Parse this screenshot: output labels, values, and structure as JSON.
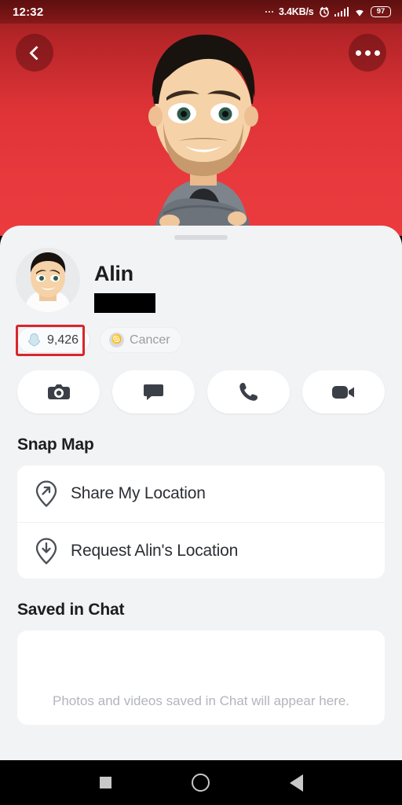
{
  "statusbar": {
    "time": "12:32",
    "network_speed": "3.4KB/s",
    "battery_level": "97",
    "icons": [
      "alarm-icon",
      "signal-icon",
      "wifi-icon",
      "battery-icon"
    ]
  },
  "hero": {
    "back_icon": "chevron-left-icon",
    "more_icon": "more-options-icon",
    "avatar_alt": "bitmoji-avatar",
    "background_color": "#e8393d"
  },
  "profile": {
    "display_name": "Alin",
    "username_redacted": "",
    "snapscore": "9,426",
    "snapscore_icon": "snapchat-ghost-icon",
    "zodiac": "Cancer",
    "zodiac_icon": "cancer-zodiac-icon",
    "highlight_color": "#d8262c"
  },
  "actions": [
    {
      "name": "camera",
      "icon": "camera-icon"
    },
    {
      "name": "chat",
      "icon": "chat-bubble-icon"
    },
    {
      "name": "call",
      "icon": "phone-icon"
    },
    {
      "name": "video",
      "icon": "video-camera-icon"
    }
  ],
  "snap_map": {
    "title": "Snap Map",
    "rows": [
      {
        "label": "Share My Location",
        "icon": "location-pin-share-icon"
      },
      {
        "label": "Request Alin's Location",
        "icon": "location-pin-request-icon"
      }
    ]
  },
  "saved_in_chat": {
    "title": "Saved in Chat",
    "empty_text": "Photos and videos saved in Chat will appear here."
  },
  "navbar": {
    "recents_icon": "square-recents-icon",
    "home_icon": "circle-home-icon",
    "back_icon": "triangle-back-icon"
  }
}
